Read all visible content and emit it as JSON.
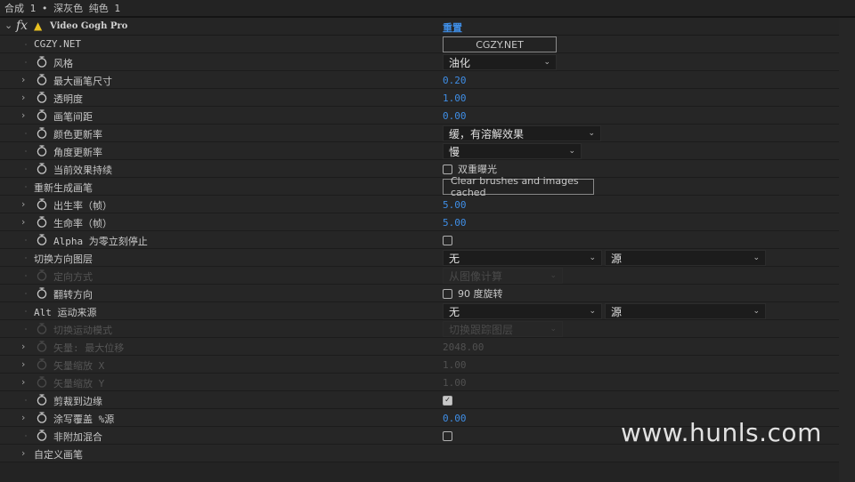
{
  "titlebar": "合成 1 • 深灰色 纯色 1",
  "effect": {
    "name": "Video Gogh Pro",
    "reset_label": "重置",
    "icon": "warning-icon"
  },
  "colors": {
    "value_blue": "#3f8ee6",
    "bg": "#232323"
  },
  "rows": [
    {
      "label": "CGZY.NET",
      "twirl": false,
      "stopwatch": false,
      "disabled": false,
      "control": {
        "type": "button",
        "label": "CGZY.NET",
        "w": 128
      }
    },
    {
      "label": "风格",
      "twirl": false,
      "stopwatch": true,
      "disabled": false,
      "control": {
        "type": "dropdown",
        "value": "油化",
        "w": 128
      }
    },
    {
      "label": "最大画笔尺寸",
      "twirl": true,
      "stopwatch": true,
      "disabled": false,
      "control": {
        "type": "value",
        "value": "0.20"
      }
    },
    {
      "label": "透明度",
      "twirl": true,
      "stopwatch": true,
      "disabled": false,
      "control": {
        "type": "value",
        "value": "1.00"
      }
    },
    {
      "label": "画笔间距",
      "twirl": true,
      "stopwatch": true,
      "disabled": false,
      "control": {
        "type": "value",
        "value": "0.00"
      }
    },
    {
      "label": "颜色更新率",
      "twirl": false,
      "stopwatch": true,
      "disabled": false,
      "control": {
        "type": "dropdown",
        "value": "缓，有溶解效果",
        "w": 178
      }
    },
    {
      "label": "角度更新率",
      "twirl": false,
      "stopwatch": true,
      "disabled": false,
      "control": {
        "type": "dropdown",
        "value": "慢",
        "w": 156
      }
    },
    {
      "label": "当前效果持续",
      "twirl": false,
      "stopwatch": true,
      "disabled": false,
      "control": {
        "type": "checkbox",
        "checked": false,
        "label": "双重曝光"
      }
    },
    {
      "label": "重新生成画笔",
      "twirl": false,
      "stopwatch": false,
      "disabled": false,
      "control": {
        "type": "button",
        "label": "Clear brushes and images cached",
        "w": 170
      }
    },
    {
      "label": "出生率（帧）",
      "twirl": true,
      "stopwatch": true,
      "disabled": false,
      "control": {
        "type": "value",
        "value": "5.00"
      }
    },
    {
      "label": "生命率（帧）",
      "twirl": true,
      "stopwatch": true,
      "disabled": false,
      "control": {
        "type": "value",
        "value": "5.00"
      }
    },
    {
      "label": "Alpha 为零立刻停止",
      "twirl": false,
      "stopwatch": true,
      "disabled": false,
      "control": {
        "type": "checkbox",
        "checked": false,
        "label": ""
      }
    },
    {
      "label": "切换方向图层",
      "twirl": false,
      "stopwatch": false,
      "disabled": false,
      "control": {
        "type": "layer",
        "value": "无",
        "source": "源"
      }
    },
    {
      "label": "定向方式",
      "twirl": false,
      "stopwatch": true,
      "disabled": true,
      "control": {
        "type": "dropdown",
        "value": "从图像计算",
        "w": 135
      }
    },
    {
      "label": "翻转方向",
      "twirl": false,
      "stopwatch": true,
      "disabled": false,
      "control": {
        "type": "checkbox",
        "checked": false,
        "label": "90 度旋转"
      }
    },
    {
      "label": "Alt 运动来源",
      "twirl": false,
      "stopwatch": false,
      "disabled": false,
      "control": {
        "type": "layer",
        "value": "无",
        "source": "源"
      }
    },
    {
      "label": "切换运动模式",
      "twirl": false,
      "stopwatch": true,
      "disabled": true,
      "control": {
        "type": "dropdown",
        "value": "切换跟踪图层",
        "w": 135
      }
    },
    {
      "label": "矢量: 最大位移",
      "twirl": true,
      "stopwatch": true,
      "disabled": true,
      "control": {
        "type": "value",
        "value": "2048.00"
      }
    },
    {
      "label": "矢量缩放 X",
      "twirl": true,
      "stopwatch": true,
      "disabled": true,
      "control": {
        "type": "value",
        "value": "1.00"
      }
    },
    {
      "label": "矢量缩放 Y",
      "twirl": true,
      "stopwatch": true,
      "disabled": true,
      "control": {
        "type": "value",
        "value": "1.00"
      }
    },
    {
      "label": "剪裁到边缘",
      "twirl": false,
      "stopwatch": true,
      "disabled": false,
      "control": {
        "type": "checkbox",
        "checked": true,
        "label": ""
      }
    },
    {
      "label": "涂写覆盖 %源",
      "twirl": true,
      "stopwatch": true,
      "disabled": false,
      "control": {
        "type": "value",
        "value": "0.00"
      }
    },
    {
      "label": "非附加混合",
      "twirl": false,
      "stopwatch": true,
      "disabled": false,
      "control": {
        "type": "checkbox",
        "checked": false,
        "label": ""
      }
    },
    {
      "label": "自定义画笔",
      "twirl": true,
      "stopwatch": false,
      "disabled": false,
      "control": {
        "type": "none"
      }
    }
  ],
  "watermark": "www.hunls.com"
}
